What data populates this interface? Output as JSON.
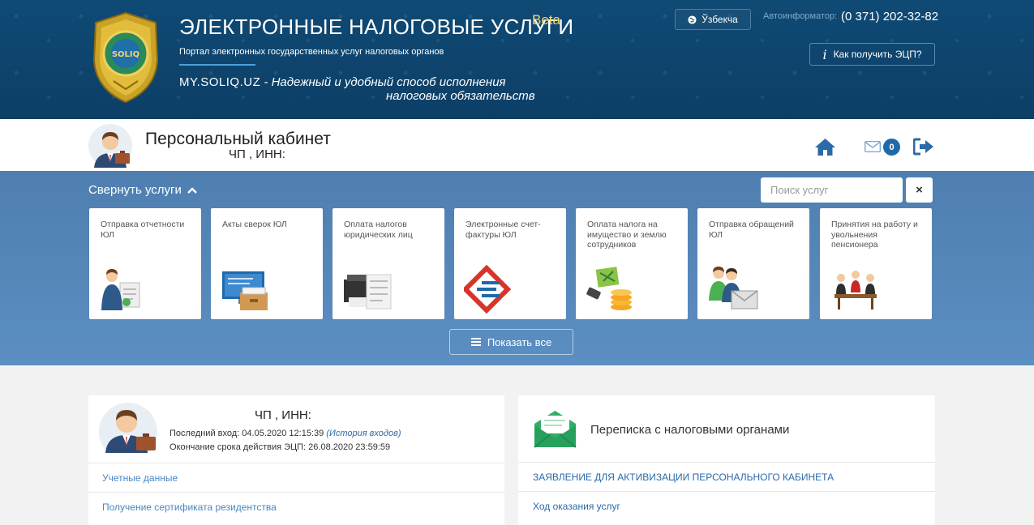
{
  "header": {
    "title": "ЭЛЕКТРОННЫЕ НАЛОГОВЫЕ УСЛУГИ",
    "beta": "Beta",
    "subtitle": "Портал электронных государственных услуг налоговых органов",
    "slogan_brand": "MY.SOLIQ.UZ",
    "slogan_line1": " - Надежный и удобный способ исполнения",
    "slogan_line2": "налоговых обязательств",
    "lang_label": "Ўзбекча",
    "autoinfo_label": "Автоинформатор:",
    "phone": "(0 371) 202-32-82",
    "ecp_label": "Как получить ЭЦП?",
    "emblem_text": "SOLIQ"
  },
  "cabinet": {
    "title": "Персональный кабинет",
    "subtitle": "ЧП , ИНН:",
    "mail_count": "0"
  },
  "services": {
    "collapse_label": "Свернуть услуги",
    "search_placeholder": "Поиск услуг",
    "clear_label": "×",
    "show_all_label": "Показать все",
    "cards": [
      {
        "label": "Отправка отчетности ЮЛ",
        "icon": "person-document-icon"
      },
      {
        "label": "Акты сверок ЮЛ",
        "icon": "monitor-archive-icon"
      },
      {
        "label": "Оплата налогов юридических лиц",
        "icon": "printer-document-icon"
      },
      {
        "label": "Электронные счет-фактуры ЮЛ",
        "icon": "e-invoice-logo-icon"
      },
      {
        "label": "Оплата налога на имущество и землю сотрудников",
        "icon": "map-coins-icon"
      },
      {
        "label": "Отправка обращений ЮЛ",
        "icon": "people-envelope-icon"
      },
      {
        "label": "Принятия на работу и увольнения пенсионера",
        "icon": "meeting-people-icon"
      }
    ]
  },
  "profile": {
    "name": "ЧП , ИНН:",
    "last_login_label": "Последний вход: ",
    "last_login_value": "04.05.2020 12:15:39",
    "history_label": "(История входов)",
    "ecp_expiry_label": "Окончание срока действия ЭЦП: ",
    "ecp_expiry_value": "26.08.2020 23:59:59",
    "links": [
      "Учетные данные",
      "Получение сертификата резидентства"
    ]
  },
  "correspondence": {
    "title": "Переписка с налоговыми органами",
    "links": [
      "ЗАЯВЛЕНИЕ ДЛЯ АКТИВИЗАЦИИ ПЕРСОНАЛЬНОГО КАБИНЕТА",
      "Ход оказания услуг"
    ]
  },
  "colors": {
    "header_bg": "#0f4a75",
    "services_bg": "#5585b8",
    "link": "#2b6aa8",
    "badge": "#1e6aa8",
    "beta": "#f5d36b"
  }
}
